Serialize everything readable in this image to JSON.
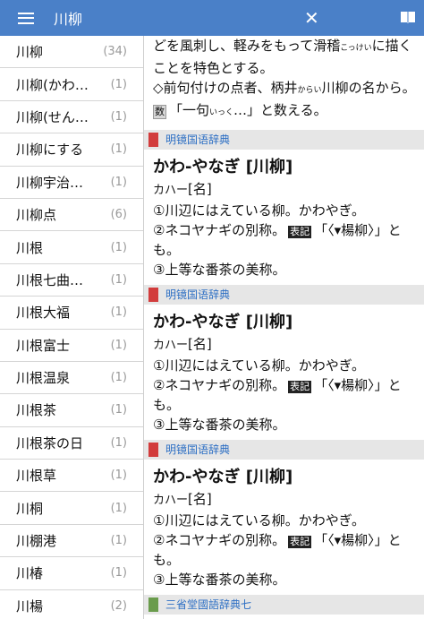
{
  "appbar": {
    "title": "川柳"
  },
  "sidebar": {
    "items": [
      {
        "label": "川柳",
        "count": "(34)"
      },
      {
        "label": "川柳(かわ…",
        "count": "(1)"
      },
      {
        "label": "川柳(せん…",
        "count": "(1)"
      },
      {
        "label": "川柳にする",
        "count": "(1)"
      },
      {
        "label": "川柳宇治…",
        "count": "(1)"
      },
      {
        "label": "川柳点",
        "count": "(6)"
      },
      {
        "label": "川根",
        "count": "(1)"
      },
      {
        "label": "川根七曲…",
        "count": "(1)"
      },
      {
        "label": "川根大福",
        "count": "(1)"
      },
      {
        "label": "川根富士",
        "count": "(1)"
      },
      {
        "label": "川根温泉",
        "count": "(1)"
      },
      {
        "label": "川根茶",
        "count": "(1)"
      },
      {
        "label": "川根茶の日",
        "count": "(1)"
      },
      {
        "label": "川根草",
        "count": "(1)"
      },
      {
        "label": "川桐",
        "count": "(1)"
      },
      {
        "label": "川棚港",
        "count": "(1)"
      },
      {
        "label": "川椿",
        "count": "(1)"
      },
      {
        "label": "川楊",
        "count": "(2)"
      }
    ]
  },
  "content": {
    "intro_line1": "どを風刺し、軽みをもって滑稽",
    "intro_ruby": "こっけい",
    "intro_line1b": "に描く",
    "intro_line2": "ことを特色とする。",
    "intro_line3a": "◇前句付けの点者、柄井",
    "intro_ruby2": "からい",
    "intro_line3b": "川柳の名から。",
    "count_badge": "数",
    "intro_line4": "「一句",
    "intro_ruby3": "いっく",
    "intro_line4b": "…」と数える。",
    "dict1": "明镜国语辞典",
    "dict2": "明镜国语辞典",
    "dict3": "明镜国语辞典",
    "dict4": "三省堂國語辞典七",
    "headword": "かわ-やなぎ [川柳]",
    "reading": "カハー",
    "pos": "[名]",
    "sense1": "①川辺にはえている柳。かわやぎ。",
    "sense2": "②ネコヤナギの別称。",
    "hyouki": "表記",
    "sense2b": "「〈▾楊柳〉」と",
    "sense2c": "も。",
    "sense3": "③上等な番茶の美称。"
  }
}
